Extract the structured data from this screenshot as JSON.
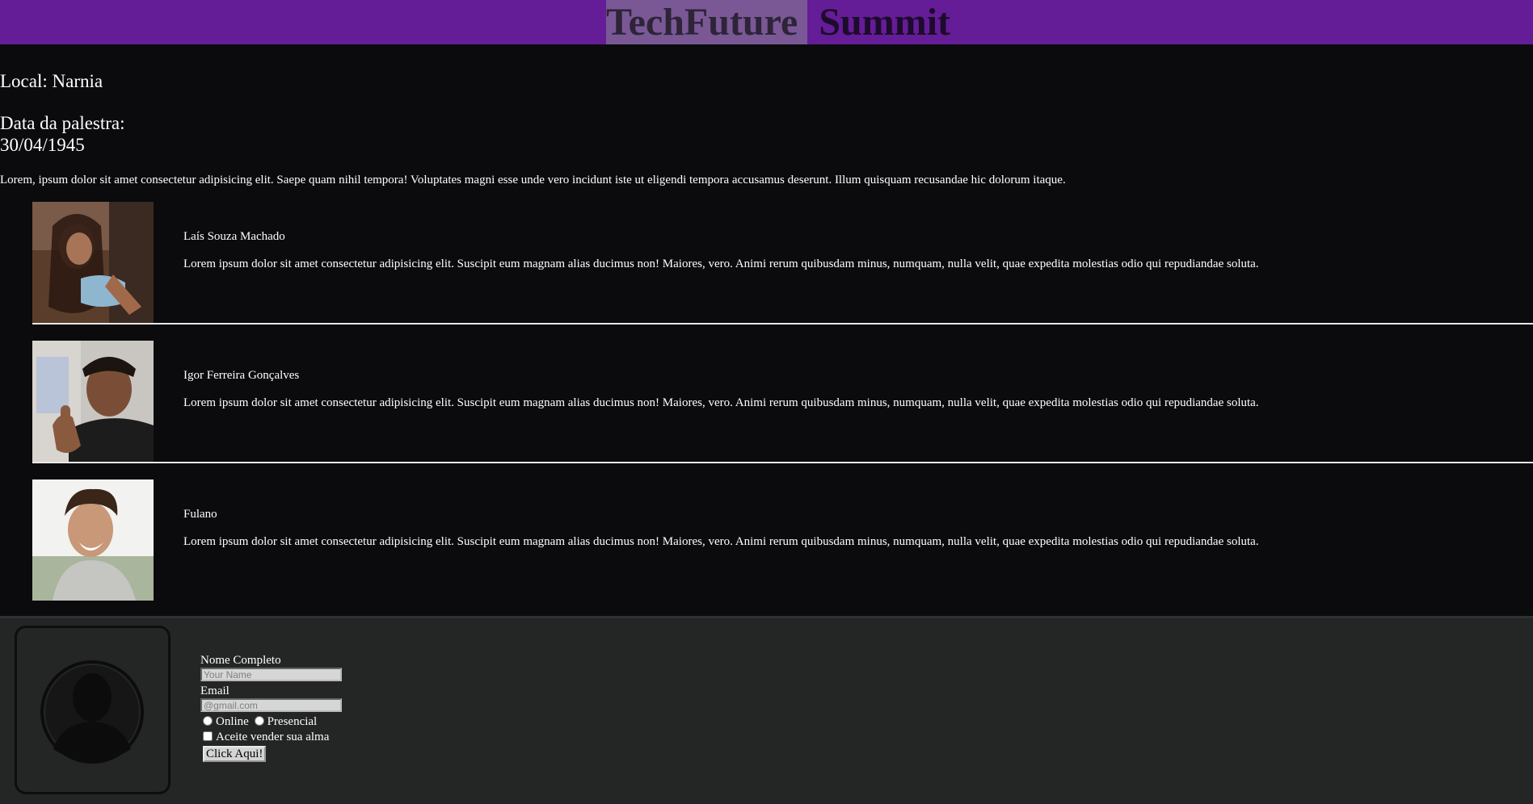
{
  "header": {
    "title_part1": "TechFuture",
    "title_part2": " Summit",
    "background": "#651c97"
  },
  "event": {
    "local": "Local: Narnia",
    "date_label": "Data da palestra:",
    "date_value": "30/04/1945",
    "intro": "Lorem, ipsum dolor sit amet consectetur adipisicing elit. Saepe quam nihil tempora! Voluptates magni esse unde vero incidunt iste ut eligendi tempora accusamus deserunt. Illum quisquam recusandae hic dolorum itaque."
  },
  "speakers": [
    {
      "name": "Laís Souza Machado",
      "bio": "Lorem ipsum dolor sit amet consectetur adipisicing elit. Suscipit eum magnam alias ducimus non! Maiores, vero. Animi rerum quibusdam minus, numquam, nulla velit, quae expedita molestias odio qui repudiandae soluta."
    },
    {
      "name": "Igor Ferreira Gonçalves",
      "bio": "Lorem ipsum dolor sit amet consectetur adipisicing elit. Suscipit eum magnam alias ducimus non! Maiores, vero. Animi rerum quibusdam minus, numquam, nulla velit, quae expedita molestias odio qui repudiandae soluta."
    },
    {
      "name": "Fulano",
      "bio": "Lorem ipsum dolor sit amet consectetur adipisicing elit. Suscipit eum magnam alias ducimus non! Maiores, vero. Animi rerum quibusdam minus, numquam, nulla velit, quae expedita molestias odio qui repudiandae soluta."
    }
  ],
  "form": {
    "name_label": "Nome Completo",
    "name_placeholder": "Your Name",
    "email_label": "Email",
    "email_placeholder": "@gmail.com",
    "radio_online": "Online",
    "radio_presencial": "Presencial",
    "checkbox_label": "Aceite vender sua alma",
    "submit_label": "Click Aqui!"
  },
  "icons": {
    "avatar": "user-silhouette-icon"
  }
}
